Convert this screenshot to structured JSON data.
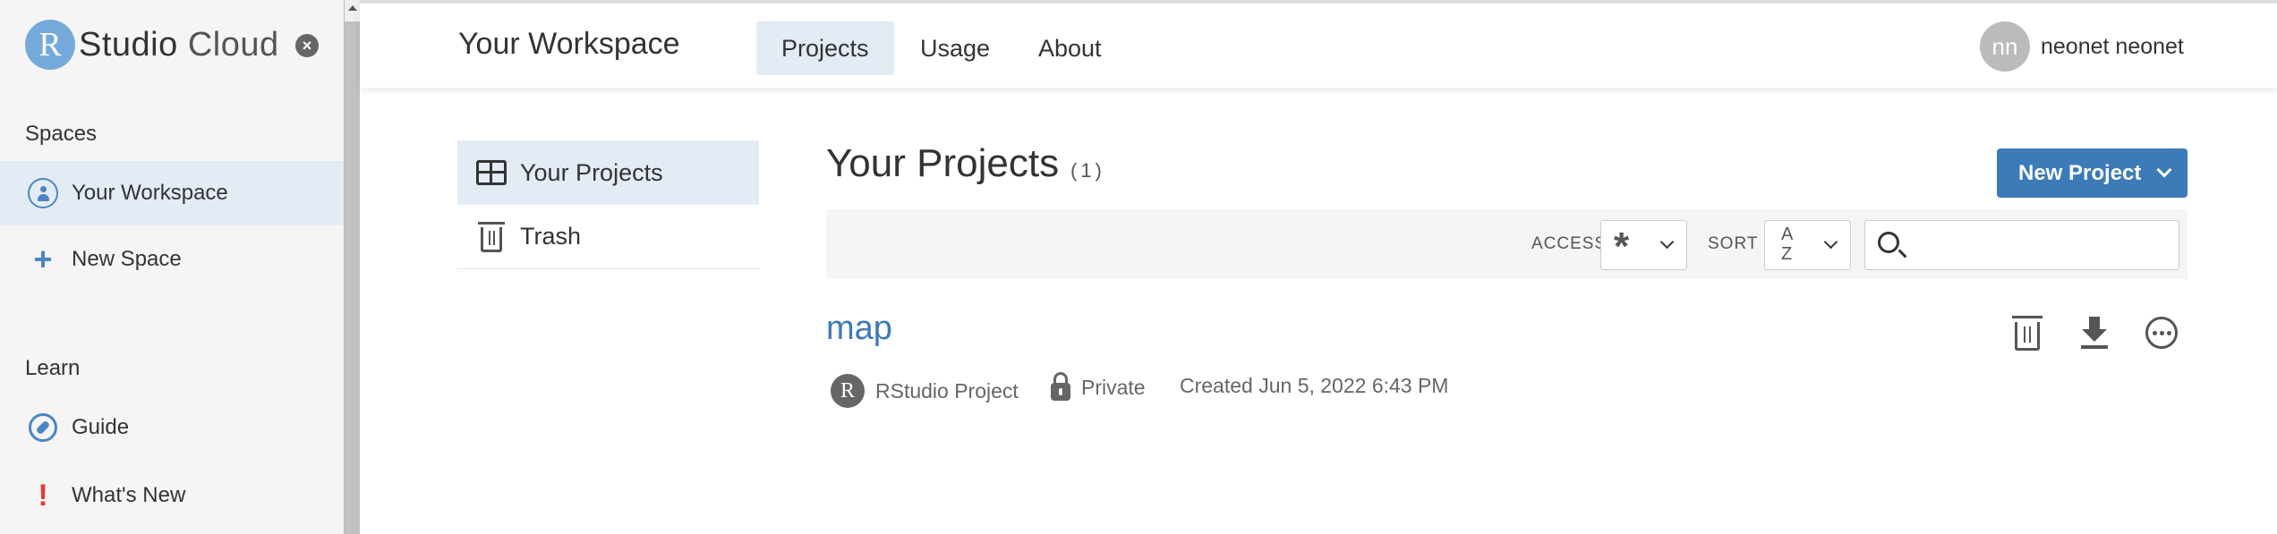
{
  "sidebar": {
    "logo_r": "R",
    "logo_main": "Studio",
    "logo_sub": "Cloud",
    "spaces_heading": "Spaces",
    "workspace_label": "Your Workspace",
    "new_space_label": "New Space",
    "learn_heading": "Learn",
    "guide_label": "Guide",
    "whats_new_label": "What's New",
    "close_glyph": "×"
  },
  "header": {
    "title": "Your Workspace",
    "tabs": [
      {
        "label": "Projects",
        "active": true
      },
      {
        "label": "Usage",
        "active": false
      },
      {
        "label": "About",
        "active": false
      }
    ],
    "avatar_initials": "nn",
    "username": "neonet neonet"
  },
  "project_nav": {
    "items": [
      {
        "label": "Your Projects",
        "icon": "grid-icon",
        "active": true
      },
      {
        "label": "Trash",
        "icon": "trash-icon",
        "active": false
      }
    ]
  },
  "main": {
    "title": "Your Projects",
    "count": "(1)",
    "new_project_label": "New Project",
    "access_label": "ACCESS",
    "access_value": "*",
    "sort_label": "SORT",
    "sort_value_top": "A",
    "sort_value_bottom": "Z",
    "search_placeholder": ""
  },
  "projects": [
    {
      "name": "map",
      "type_icon": "R",
      "type": "RStudio Project",
      "visibility": "Private",
      "created": "Created Jun 5, 2022 6:43 PM"
    }
  ],
  "colors": {
    "accent": "#3d7ab8",
    "logo_circle": "#75a9dc",
    "active_bg": "#e3ebf5",
    "alert": "#e53935"
  }
}
